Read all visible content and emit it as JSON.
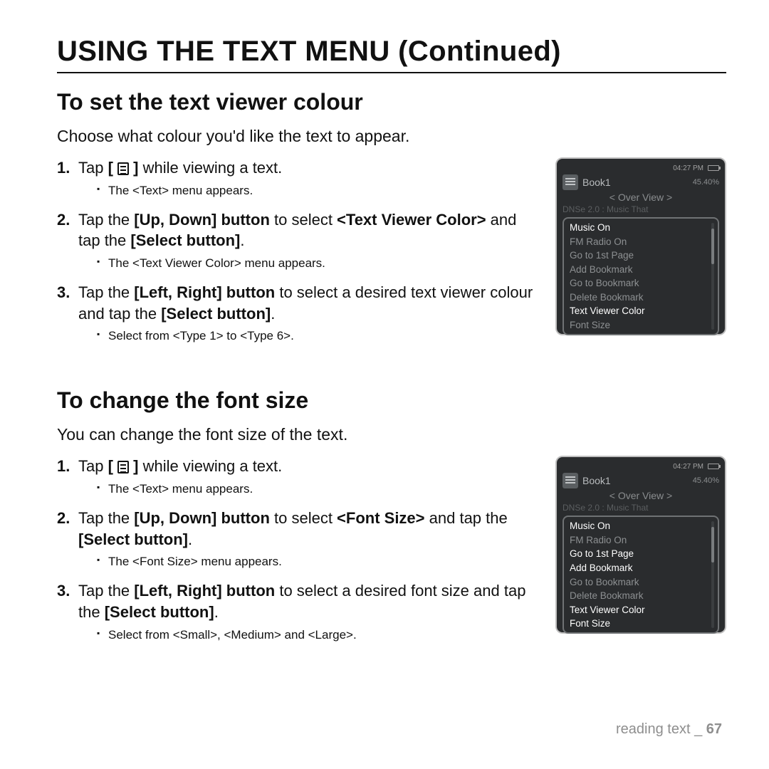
{
  "page_title": "USING THE TEXT MENU (Continued)",
  "section1": {
    "title": "To set the text viewer colour",
    "intro": "Choose what colour you'd like the text to appear.",
    "steps": {
      "s1": {
        "num": "1.",
        "pre": "Tap ",
        "bracket_open": "[ ",
        "bracket_close": " ]",
        "post": " while viewing a text.",
        "sub": "The <Text> menu appears."
      },
      "s2": {
        "num": "2.",
        "t1": "Tap the ",
        "b1": "[Up, Down] button",
        "t2": " to select ",
        "b2": "<Text Viewer Color>",
        "t3": " and tap the ",
        "b3": "[Select button]",
        "t4": ".",
        "sub": "The <Text Viewer Color> menu appears."
      },
      "s3": {
        "num": "3.",
        "t1": "Tap the ",
        "b1": "[Left, Right] button",
        "t2": " to select a desired text viewer colour and tap the ",
        "b2": "[Select button]",
        "t3": ".",
        "sub": "Select from <Type 1> to <Type 6>."
      }
    }
  },
  "section2": {
    "title": "To change the font size",
    "intro": "You can change the font size of the text.",
    "steps": {
      "s1": {
        "num": "1.",
        "pre": "Tap ",
        "bracket_open": "[ ",
        "bracket_close": " ]",
        "post": " while viewing a text.",
        "sub": "The <Text> menu appears."
      },
      "s2": {
        "num": "2.",
        "t1": "Tap the ",
        "b1": "[Up, Down] button",
        "t2": " to select ",
        "b2": "<Font Size>",
        "t3": " and tap the ",
        "b3": "[Select button]",
        "t4": ".",
        "sub": "The <Font Size> menu appears."
      },
      "s3": {
        "num": "3.",
        "t1": "Tap the ",
        "b1": "[Left, Right] button",
        "t2": " to select a desired font size and tap the ",
        "b2": "[Select button]",
        "t3": ".",
        "sub": "Select from <Small>, <Medium> and <Large>."
      }
    }
  },
  "device": {
    "time": "04:27 PM",
    "book": "Book1",
    "pct": "45.40%",
    "overview": "< Over View >",
    "faint": "DNSe 2.0 : Music That",
    "menu": [
      "Music On",
      "FM Radio On",
      "Go to 1st Page",
      "Add Bookmark",
      "Go to Bookmark",
      "Delete Bookmark",
      "Text Viewer Color",
      "Font Size"
    ],
    "sel1": "Text Viewer Color",
    "sel2": "Font Size"
  },
  "footer": {
    "label": "reading text _ ",
    "page": "67"
  }
}
